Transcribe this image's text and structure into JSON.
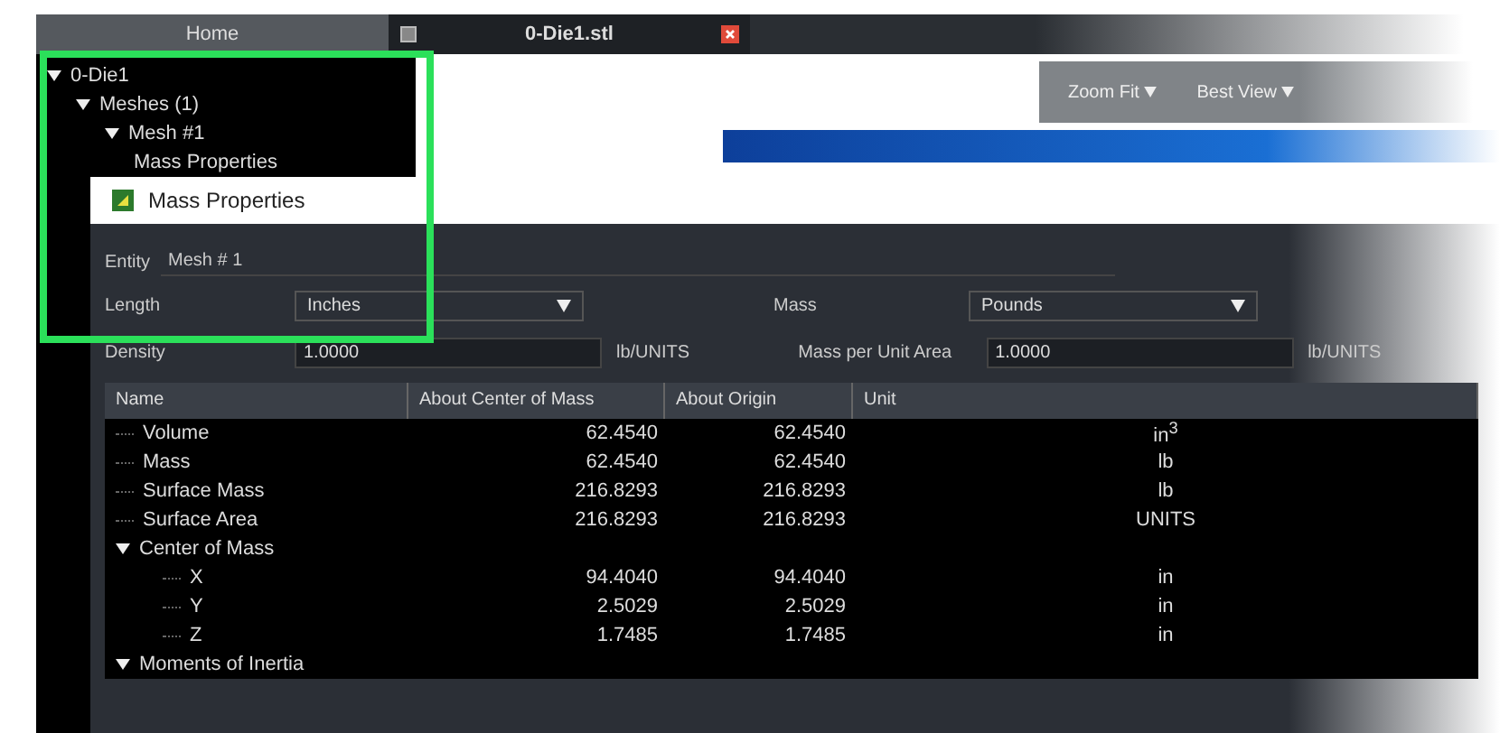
{
  "tabs": [
    {
      "label": "Home",
      "selected": false
    },
    {
      "label": "0-Die1.stl",
      "selected": true
    }
  ],
  "tree": [
    {
      "label": "0-Die1",
      "expanded": true,
      "children": [
        {
          "label": "Meshes (1)",
          "expanded": true,
          "children": [
            {
              "label": "Mesh #1",
              "expanded": true,
              "children": [
                {
                  "label": "Mass Properties"
                }
              ]
            }
          ]
        }
      ]
    }
  ],
  "viewport_toolbar": [
    {
      "label": "Zoom Fit"
    },
    {
      "label": "Best View"
    }
  ],
  "dialog": {
    "title": "Mass Properties",
    "entity": {
      "label": "Entity",
      "value": "Mesh # 1"
    },
    "length": {
      "label": "Length",
      "value": "Inches"
    },
    "mass": {
      "label": "Mass",
      "value": "Pounds"
    },
    "density": {
      "label": "Density",
      "value": "1.0000",
      "unit": "lb/UNITS"
    },
    "mass_per_area": {
      "label": "Mass per Unit Area",
      "value": "1.0000",
      "unit": "lb/UNITS"
    },
    "table": {
      "columns": [
        "Name",
        "About Center of Mass",
        "About Origin",
        "Unit"
      ],
      "rows": [
        {
          "name": "Volume",
          "center": "62.4540",
          "origin": "62.4540",
          "unit": "in$^{3}$"
        },
        {
          "name": "Mass",
          "center": "62.4540",
          "origin": "62.4540",
          "unit": "lb"
        },
        {
          "name": "Surface Mass",
          "center": "216.8293",
          "origin": "216.8293",
          "unit": "lb"
        },
        {
          "name": "Surface Area",
          "center": "216.8293",
          "origin": "216.8293",
          "unit": "UNITS"
        },
        {
          "name": "Center of Mass",
          "expanded": true,
          "children": [
            {
              "name": "X",
              "center": "94.4040",
              "origin": "94.4040",
              "unit": "in"
            },
            {
              "name": "Y",
              "center": "2.5029",
              "origin": "2.5029",
              "unit": "in"
            },
            {
              "name": "Z",
              "center": "1.7485",
              "origin": "1.7485",
              "unit": "in"
            }
          ]
        },
        {
          "name": "Moments of Inertia",
          "expanded": true
        }
      ]
    }
  }
}
